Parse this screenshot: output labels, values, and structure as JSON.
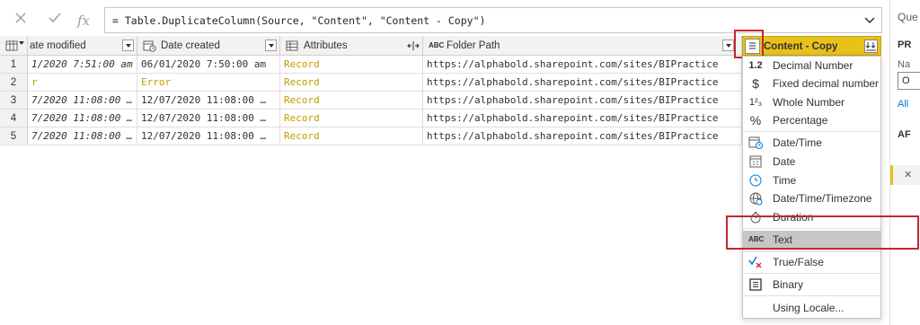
{
  "formula": {
    "text": "= Table.DuplicateColumn(Source, \"Content\", \"Content - Copy\")",
    "cancel_icon": "close-icon",
    "confirm_icon": "check-icon",
    "fx_label": "fx"
  },
  "right_pane": {
    "items": [
      "Que",
      "PR",
      "Na",
      "O",
      "All",
      "AF"
    ]
  },
  "columns": [
    {
      "label": "ate modified",
      "icon": "calendar-icon"
    },
    {
      "label": "Date created",
      "icon": "calendar-clock-icon"
    },
    {
      "label": "Attributes",
      "icon": "table-icon"
    },
    {
      "label": "Folder Path",
      "icon": "text-type-icon",
      "icon_text": "ABC"
    },
    {
      "label": "Content - Copy",
      "icon": "any-type-icon"
    }
  ],
  "rows": [
    {
      "num": "1",
      "modified": "1/2020 7:51:00 am",
      "created": "06/01/2020 7:50:00 am",
      "attributes": "Record",
      "path": "https://alphabold.sharepoint.com/sites/BIPractice"
    },
    {
      "num": "2",
      "modified": "r",
      "created": "Error",
      "attributes": "Record",
      "path": "https://alphabold.sharepoint.com/sites/BIPractice"
    },
    {
      "num": "3",
      "modified": "7/2020 11:08:00 …",
      "created": "12/07/2020 11:08:00 …",
      "attributes": "Record",
      "path": "https://alphabold.sharepoint.com/sites/BIPractice"
    },
    {
      "num": "4",
      "modified": "7/2020 11:08:00 …",
      "created": "12/07/2020 11:08:00 …",
      "attributes": "Record",
      "path": "https://alphabold.sharepoint.com/sites/BIPractice"
    },
    {
      "num": "5",
      "modified": "7/2020 11:08:00 …",
      "created": "12/07/2020 11:08:00 …",
      "attributes": "Record",
      "path": "https://alphabold.sharepoint.com/sites/BIPractice"
    }
  ],
  "menu": {
    "items": [
      {
        "label": "Decimal Number",
        "icon": "1.2"
      },
      {
        "label": "Fixed decimal number",
        "icon": "$"
      },
      {
        "label": "Whole Number",
        "icon": "1²₃"
      },
      {
        "label": "Percentage",
        "icon": "%"
      },
      {
        "label": "Date/Time",
        "icon": "calendar-clock"
      },
      {
        "label": "Date",
        "icon": "calendar"
      },
      {
        "label": "Time",
        "icon": "clock"
      },
      {
        "label": "Date/Time/Timezone",
        "icon": "globe"
      },
      {
        "label": "Duration",
        "icon": "stopwatch"
      },
      {
        "label": "Text",
        "icon": "ABC"
      },
      {
        "label": "True/False",
        "icon": "check-x"
      },
      {
        "label": "Binary",
        "icon": "binary"
      },
      {
        "label": "Using Locale...",
        "icon": ""
      }
    ],
    "highlighted": "Text"
  },
  "colors": {
    "selected_header": "#e8c21b",
    "error_text": "#c19c00",
    "highlight_box": "#c4262e"
  }
}
